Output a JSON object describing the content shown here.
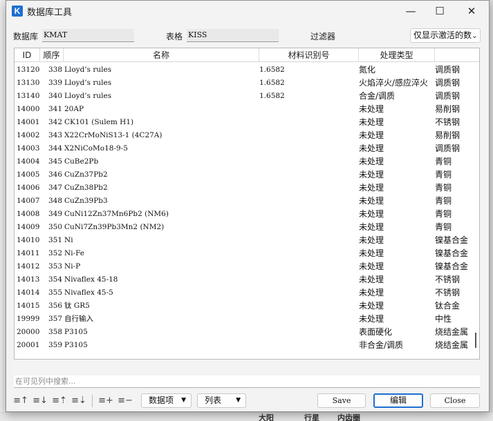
{
  "window": {
    "title": "数据库工具",
    "app_icon_letter": "K"
  },
  "filters": {
    "database_label": "数据库",
    "database_value": "KMAT",
    "table_label": "表格",
    "table_value": "KISS",
    "filter_label": "过滤器",
    "filter_value": "仅显示激活的数"
  },
  "grid": {
    "columns": [
      "ID",
      "顺序",
      "名称",
      "材料识别号",
      "处理类型",
      ""
    ],
    "rows": [
      [
        "13120",
        "338",
        "Lloyd’s rules",
        "1.6582",
        "氮化",
        "调质钢"
      ],
      [
        "13130",
        "339",
        "Lloyd’s rules",
        "1.6582",
        "火焰淬火/感应淬火",
        "调质钢"
      ],
      [
        "13140",
        "340",
        "Lloyd’s rules",
        "1.6582",
        "合金/调质",
        "调质钢"
      ],
      [
        "14000",
        "341",
        "20AP",
        "",
        "未处理",
        "易削钢"
      ],
      [
        "14001",
        "342",
        "CK101 (Sulem H1)",
        "",
        "未处理",
        "不锈钢"
      ],
      [
        "14002",
        "343",
        "X22CrMoNiS13-1 (4C27A)",
        "",
        "未处理",
        "易削钢"
      ],
      [
        "14003",
        "344",
        "X2NiCoMo18-9-5",
        "",
        "未处理",
        "调质钢"
      ],
      [
        "14004",
        "345",
        "CuBe2Pb",
        "",
        "未处理",
        "青铜"
      ],
      [
        "14005",
        "346",
        "CuZn37Pb2",
        "",
        "未处理",
        "青铜"
      ],
      [
        "14006",
        "347",
        "CuZn38Pb2",
        "",
        "未处理",
        "青铜"
      ],
      [
        "14007",
        "348",
        "CuZn39Pb3",
        "",
        "未处理",
        "青铜"
      ],
      [
        "14008",
        "349",
        "CuNi12Zn37Mn6Pb2 (NM6)",
        "",
        "未处理",
        "青铜"
      ],
      [
        "14009",
        "350",
        "CuNi7Zn39Pb3Mn2 (NM2)",
        "",
        "未处理",
        "青铜"
      ],
      [
        "14010",
        "351",
        "Ni",
        "",
        "未处理",
        "镍基合金"
      ],
      [
        "14011",
        "352",
        "Ni-Fe",
        "",
        "未处理",
        "镍基合金"
      ],
      [
        "14012",
        "353",
        "Ni-P",
        "",
        "未处理",
        "镍基合金"
      ],
      [
        "14013",
        "354",
        "Nivaflex 45-18",
        "",
        "未处理",
        "不锈钢"
      ],
      [
        "14014",
        "355",
        "Nivaflex 45-5",
        "",
        "未处理",
        "不锈钢"
      ],
      [
        "14015",
        "356",
        "钛 GR5",
        "",
        "未处理",
        "钛合金"
      ],
      [
        "19999",
        "357",
        "自行输入",
        "",
        "未处理",
        "中性"
      ],
      [
        "20000",
        "358",
        "P3105",
        "",
        "表面硬化",
        "烧结金属"
      ],
      [
        "20001",
        "359",
        "P3105",
        "",
        "非合金/调质",
        "烧结金属"
      ]
    ]
  },
  "search": {
    "placeholder": "在可见列中搜索..."
  },
  "toolbar": {
    "fields_dropdown": "数据项",
    "columns_dropdown": "列表",
    "save_label": "Save",
    "edit_label": "编辑",
    "close_label": "Close"
  },
  "background": {
    "bottom_labels": [
      "大阳",
      "行星",
      "内齿圈"
    ]
  }
}
